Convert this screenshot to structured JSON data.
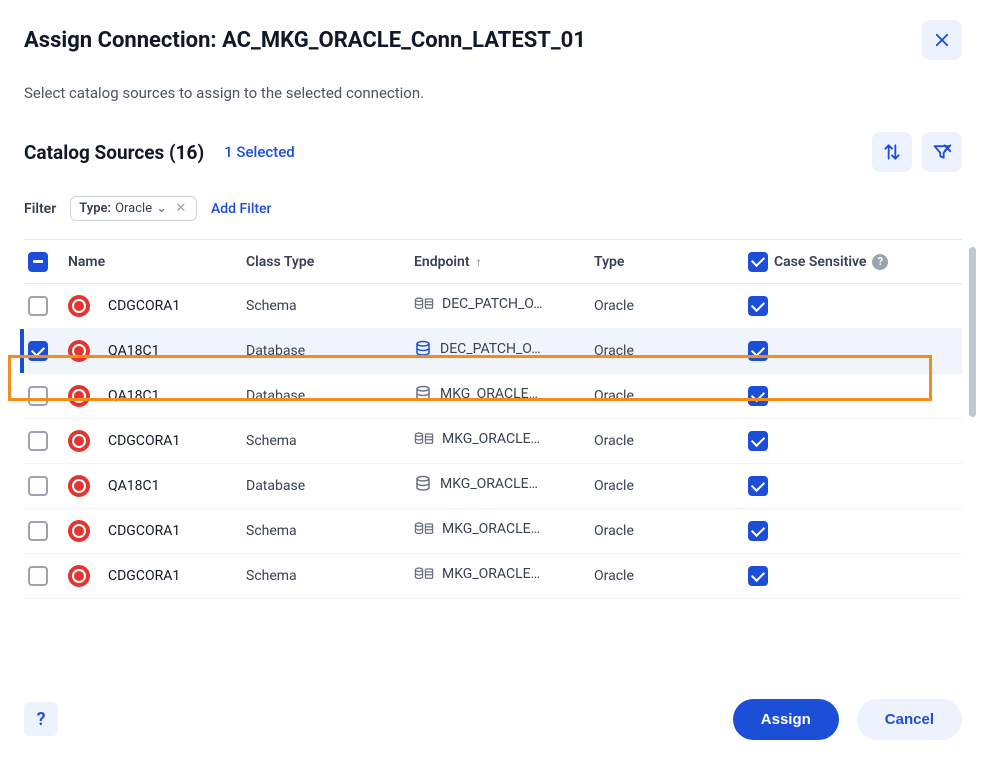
{
  "dialog": {
    "title": "Assign Connection: AC_MKG_ORACLE_Conn_LATEST_01",
    "subtitle": "Select catalog sources to assign to the selected connection."
  },
  "section": {
    "title": "Catalog Sources (16)",
    "selected_text": "1 Selected"
  },
  "filter": {
    "label": "Filter",
    "chip_prefix": "Type:",
    "chip_value": "Oracle",
    "add_filter": "Add Filter"
  },
  "table": {
    "headers": {
      "name": "Name",
      "class_type": "Class Type",
      "endpoint": "Endpoint",
      "type": "Type",
      "case_sensitive": "Case Sensitive"
    },
    "rows": [
      {
        "checked": false,
        "name": "CDGCORA1",
        "class_type": "Schema",
        "endpoint": "DEC_PATCH_O…",
        "ep_icon": "schema",
        "type": "Oracle",
        "case_sensitive": true,
        "selected": false
      },
      {
        "checked": true,
        "name": "QA18C1",
        "class_type": "Database",
        "endpoint": "DEC_PATCH_O…",
        "ep_icon": "db-blue",
        "type": "Oracle",
        "case_sensitive": true,
        "selected": true
      },
      {
        "checked": false,
        "name": "QA18C1",
        "class_type": "Database",
        "endpoint": "MKG_ORACLE…",
        "ep_icon": "db-gray",
        "type": "Oracle",
        "case_sensitive": true,
        "selected": false
      },
      {
        "checked": false,
        "name": "CDGCORA1",
        "class_type": "Schema",
        "endpoint": "MKG_ORACLE…",
        "ep_icon": "schema",
        "type": "Oracle",
        "case_sensitive": true,
        "selected": false
      },
      {
        "checked": false,
        "name": "QA18C1",
        "class_type": "Database",
        "endpoint": "MKG_ORACLE…",
        "ep_icon": "db-gray",
        "type": "Oracle",
        "case_sensitive": true,
        "selected": false
      },
      {
        "checked": false,
        "name": "CDGCORA1",
        "class_type": "Schema",
        "endpoint": "MKG_ORACLE…",
        "ep_icon": "schema",
        "type": "Oracle",
        "case_sensitive": true,
        "selected": false
      },
      {
        "checked": false,
        "name": "CDGCORA1",
        "class_type": "Schema",
        "endpoint": "MKG_ORACLE…",
        "ep_icon": "schema",
        "type": "Oracle",
        "case_sensitive": true,
        "selected": false
      }
    ]
  },
  "footer": {
    "assign": "Assign",
    "cancel": "Cancel"
  },
  "icons": {
    "close": "close-icon",
    "sort": "sort-icon",
    "clear_filter": "clear-filter-icon",
    "help": "?"
  }
}
